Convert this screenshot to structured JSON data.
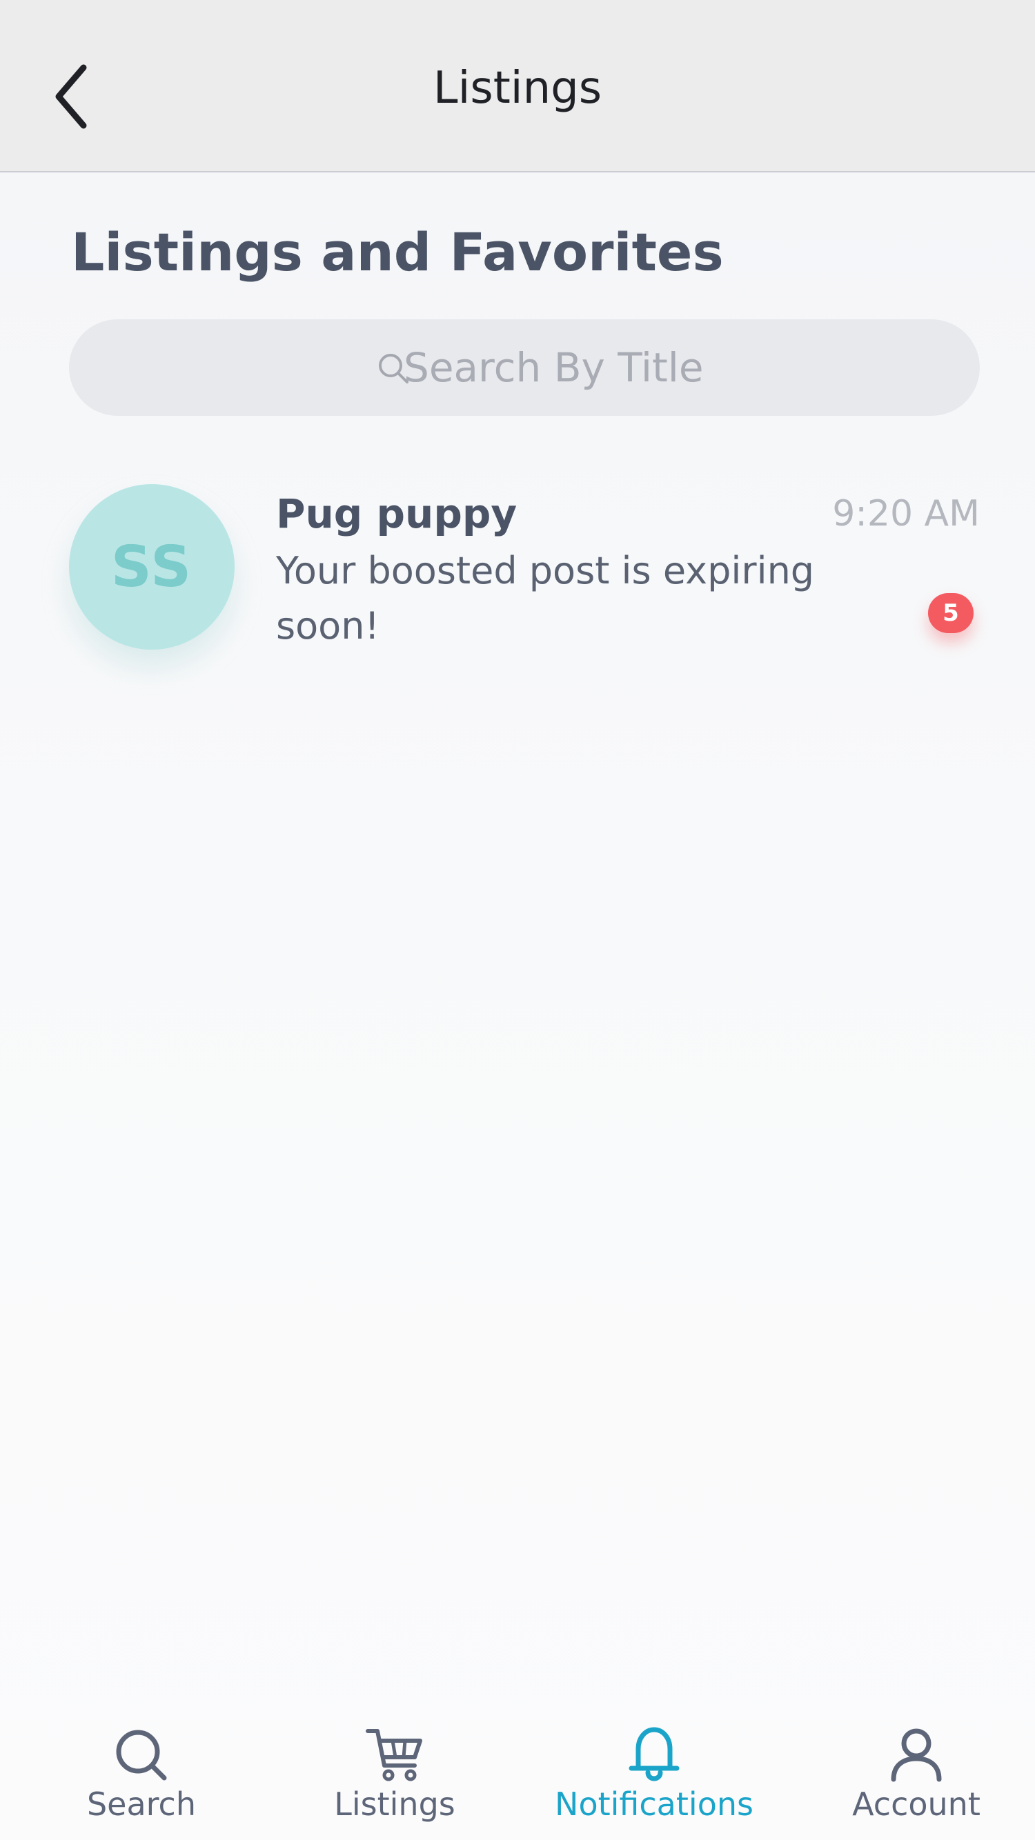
{
  "header": {
    "title": "Listings",
    "back_icon": "chevron-left-icon"
  },
  "section": {
    "title": "Listings and Favorites"
  },
  "search": {
    "placeholder": "Search By Title",
    "value": "",
    "icon": "search-icon"
  },
  "listings": [
    {
      "avatar_initials": "SS",
      "title": "Pug puppy",
      "message": "Your boosted post is expiring soon!",
      "time": "9:20 AM",
      "badge_count": "5"
    }
  ],
  "tabbar": {
    "tabs": [
      {
        "label": "Search",
        "icon": "search-icon",
        "active": false
      },
      {
        "label": "Listings",
        "icon": "cart-icon",
        "active": false
      },
      {
        "label": "Notifications",
        "icon": "bell-icon",
        "active": true
      },
      {
        "label": "Account",
        "icon": "user-icon",
        "active": false
      }
    ]
  },
  "colors": {
    "accent": "#1ba4c9",
    "text_primary": "#4b5466",
    "avatar_bg": "#b9e6e5",
    "avatar_text": "#7ccccb",
    "badge": "#f45b60",
    "header_bg": "#ececed"
  }
}
